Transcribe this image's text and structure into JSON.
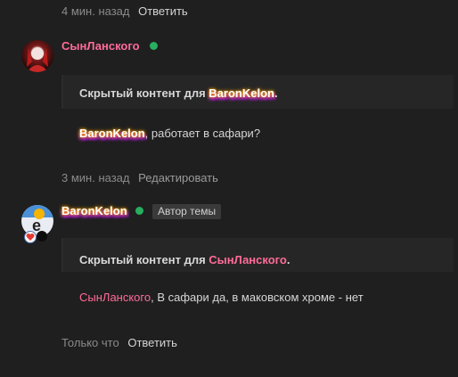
{
  "top_meta": {
    "time": "4 мин. назад",
    "reply": "Ответить"
  },
  "post1": {
    "author": "СынЛанского",
    "hidden_prefix": "Скрытый контент для ",
    "hidden_user": "BaronKelon",
    "hidden_suffix": ".",
    "mention": "BaronKelon",
    "text": ", работает в сафари?",
    "time": "3 мин. назад",
    "edit": "Редактировать"
  },
  "post2": {
    "author": "BaronKelon",
    "badge": "Автор темы",
    "hidden_prefix": "Скрытый контент для ",
    "hidden_user": "СынЛанского",
    "hidden_suffix": ".",
    "mention": "СынЛанского",
    "text": ", В сафари да, в маковском хроме - нет",
    "time": "Только что",
    "reply": "Ответить"
  },
  "colors": {
    "online": "#27ae60",
    "accent_pink": "#ff6b9a",
    "background": "#1f1f1f"
  }
}
